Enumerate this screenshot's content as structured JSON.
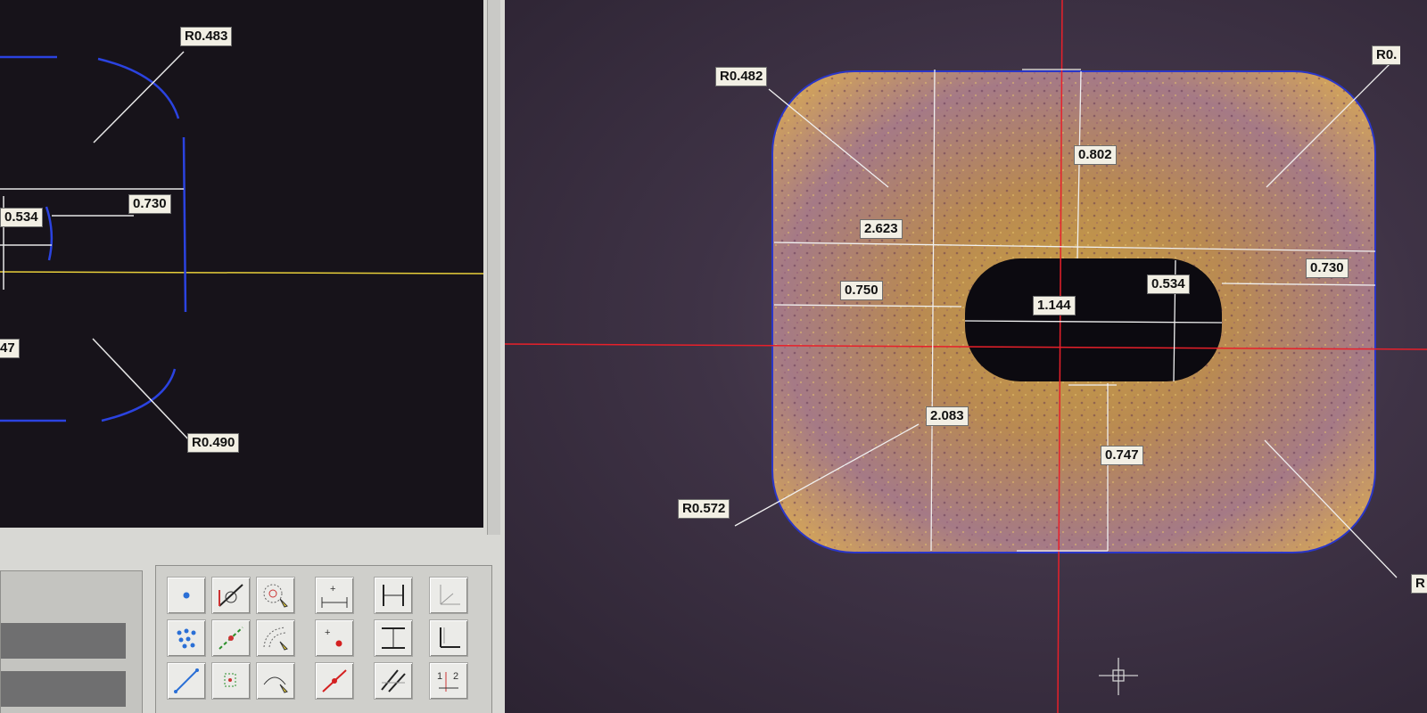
{
  "cad_view": {
    "labels": {
      "radius_top": "R0.483",
      "radius_bottom": "R0.490",
      "dim_width": "0.730",
      "dim_height": "0.534",
      "dim_partial": "47"
    }
  },
  "camera_view": {
    "labels": {
      "radius_top_left": "R0.482",
      "radius_top_right": "R0.",
      "radius_bottom_left": "R0.572",
      "radius_bottom_right": "R",
      "dim_top_gap": "0.802",
      "dim_total_width": "2.623",
      "dim_left_gap": "0.750",
      "dim_slot_length": "1.144",
      "dim_slot_height": "0.534",
      "dim_right_gap": "0.730",
      "dim_total_height": "2.083",
      "dim_bottom_gap": "0.747"
    }
  },
  "toolbar": {
    "tools": [
      "point-tool",
      "line-fit-tool",
      "circle-fit-tool",
      "distance-tool",
      "width-tool",
      "coordinate-tool",
      "multi-point-tool",
      "line-points-tool",
      "arc-tool",
      "point-distance-tool",
      "height-tool",
      "angle-tool",
      "segment-tool",
      "symmetry-tool",
      "arc-3pt-tool",
      "line-tool",
      "intersection-tool",
      "datum-tool"
    ]
  },
  "colors": {
    "crosshair": "#e8202a",
    "edge": "#2a36c8",
    "cad_line": "#2b43e0",
    "dimension": "#f0f0f0",
    "axis_yellow": "#e8cf3a"
  }
}
